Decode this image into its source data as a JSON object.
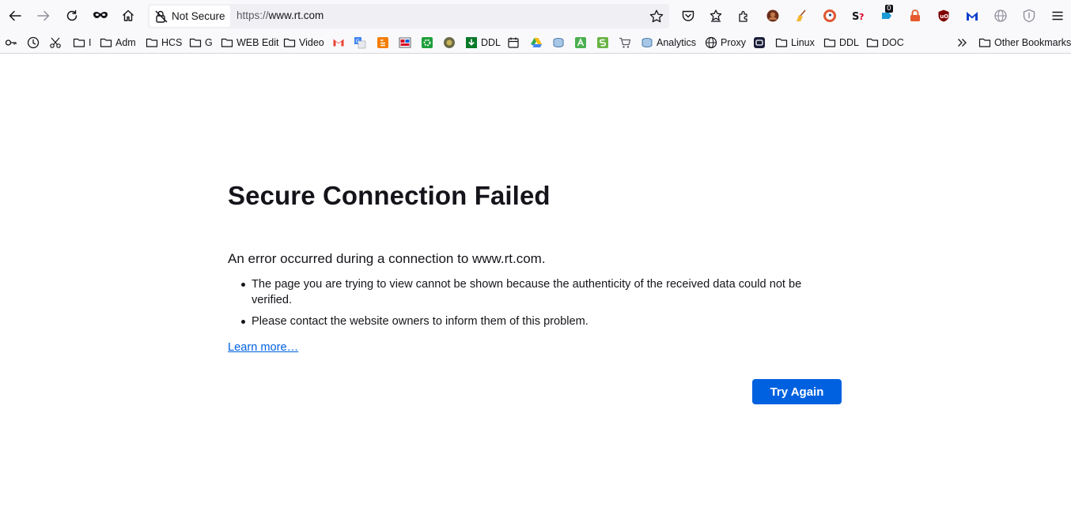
{
  "browser": {
    "site_identity_label": "Not Secure",
    "url_scheme": "https://",
    "url_host": "www.rt.com",
    "extension_badge_count": "0"
  },
  "bookmarks": {
    "items": [
      {
        "label": "I"
      },
      {
        "label": "Adm"
      },
      {
        "label": "HCS"
      },
      {
        "label": "G"
      },
      {
        "label": "WEB Edit"
      },
      {
        "label": "Video"
      },
      {
        "label": "DDL"
      },
      {
        "label": "Analytics"
      },
      {
        "label": "Proxy"
      },
      {
        "label": "Linux"
      },
      {
        "label": "DDL"
      },
      {
        "label": "DOC"
      }
    ],
    "other_bookmarks": "Other Bookmarks"
  },
  "error": {
    "title": "Secure Connection Failed",
    "intro": "An error occurred during a connection to www.rt.com.",
    "bullets": [
      "The page you are trying to view cannot be shown because the authenticity of the received data could not be verified.",
      "Please contact the website owners to inform them of this problem."
    ],
    "learn_more": "Learn more…",
    "try_again": "Try Again"
  },
  "colors": {
    "accent": "#0061e0",
    "toolbar_bg": "#f9f9fb",
    "urlbar_bg": "#f0f0f4"
  }
}
